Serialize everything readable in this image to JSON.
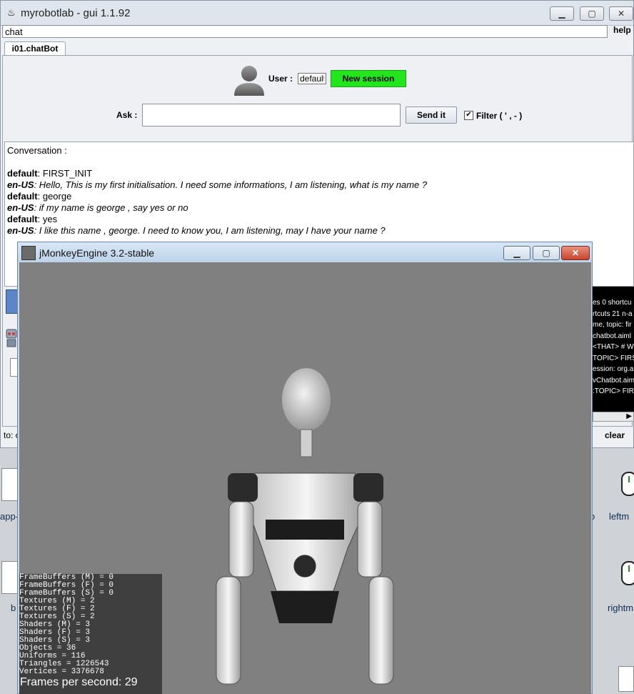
{
  "main_window": {
    "title": "myrobotlab - gui 1.1.92",
    "search_value": "chat",
    "help_label": "help",
    "tab_label": "i01.chatBot"
  },
  "chatbot": {
    "user_label": "User :",
    "user_value": "default",
    "new_session_label": "New session",
    "ask_label": "Ask :",
    "send_label": "Send it",
    "filter_label": "Filter ( ' , - )",
    "filter_checked": true,
    "conversation_heading": "Conversation :",
    "messages": [
      {
        "speaker": "default",
        "text": ": FIRST_INIT",
        "bot": false
      },
      {
        "speaker": "en-US",
        "text": ": Hello, This is my first initialisation. I need some informations, I am listening, what is my name ?",
        "bot": true
      },
      {
        "speaker": "default",
        "text": ": george",
        "bot": false
      },
      {
        "speaker": "en-US",
        "text": ": if my name is george , say yes or no",
        "bot": true
      },
      {
        "speaker": "default",
        "text": ": yes",
        "bot": false
      },
      {
        "speaker": "en-US",
        "text": ": I like this name , george. I need to know you, I am listening, may I have your name ?",
        "bot": true
      }
    ],
    "log_lines": [
      "es 0 shortcu",
      "rtcuts 21 n-a",
      "me, topic: fir",
      "chatbot.aiml",
      " <THAT> # W",
      "TOPIC> FIRS",
      "ession: org.a",
      "vChatbot.aim",
      ":TOPIC> FIR"
    ],
    "to_label": "to: c",
    "clear_label": "clear"
  },
  "desktop": {
    "labels": [
      "app-",
      "b",
      "leftm",
      "rightm",
      "o"
    ]
  },
  "jme_window": {
    "title": "jMonkeyEngine 3.2-stable",
    "stats": [
      "FrameBuffers (M) = 0",
      "FrameBuffers (F) = 0",
      "FrameBuffers (S) = 0",
      "Textures (M) = 2",
      "Textures (F) = 2",
      "Textures (S) = 2",
      "Shaders (M) = 3",
      "Shaders (F) = 3",
      "Shaders (S) = 3",
      "Objects = 36",
      "Uniforms = 116",
      "Triangles = 1226543",
      "Vertices = 3376678"
    ],
    "fps_text": "Frames per second: 29"
  }
}
